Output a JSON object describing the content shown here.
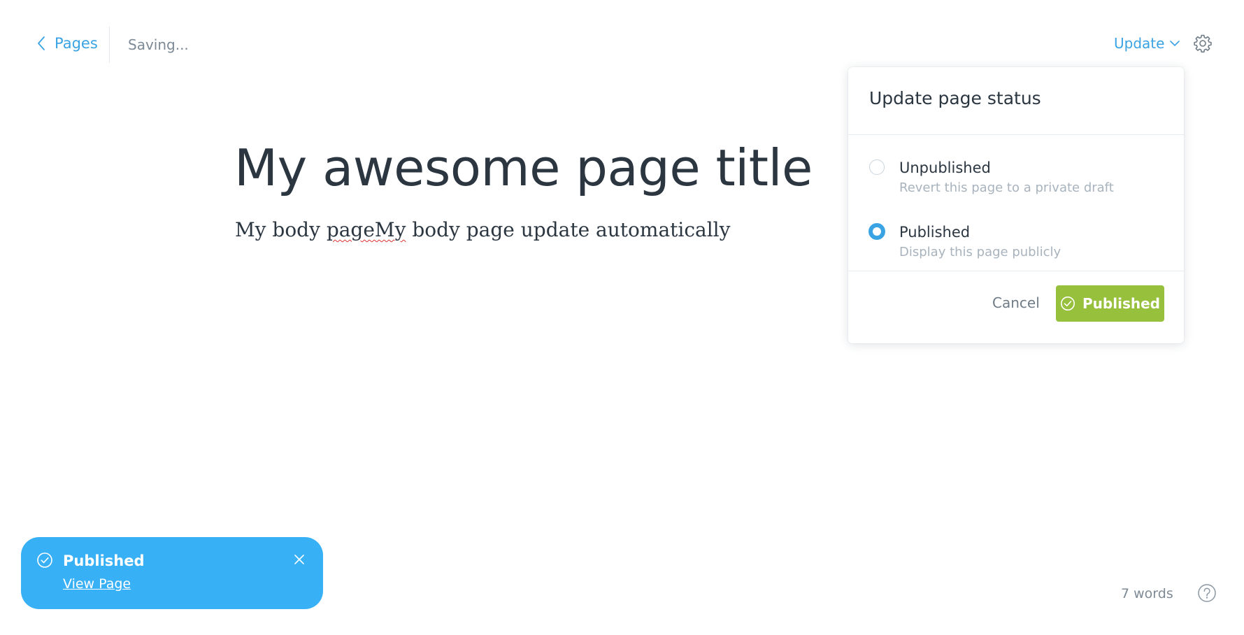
{
  "topbar": {
    "back_label": "Pages",
    "saving_text": "Saving...",
    "update_label": "Update"
  },
  "editor": {
    "title": "My awesome page title",
    "body_before": "My body ",
    "body_misspelled": "pageMy",
    "body_after": " body page update automatically"
  },
  "status_popover": {
    "title": "Update page status",
    "options": [
      {
        "label": "Unpublished",
        "description": "Revert this page to a private draft",
        "checked": false
      },
      {
        "label": "Published",
        "description": "Display this page publicly",
        "checked": true
      }
    ],
    "cancel_label": "Cancel",
    "confirm_label": "Published"
  },
  "toast": {
    "title": "Published",
    "link_label": "View Page"
  },
  "footer": {
    "word_count": "7 words"
  },
  "colors": {
    "accent": "#3aa3e3",
    "success": "#97c03d",
    "toast_bg": "#38b0f5",
    "text_dark": "#2b3641",
    "text_muted": "#7d8a95"
  },
  "icons": {
    "back": "chevron-left-icon",
    "update": "chevron-down-icon",
    "settings": "gear-icon",
    "confirm": "check-circle-icon",
    "toast": "check-circle-icon",
    "toast_close": "close-icon",
    "help": "question-circle-icon"
  }
}
